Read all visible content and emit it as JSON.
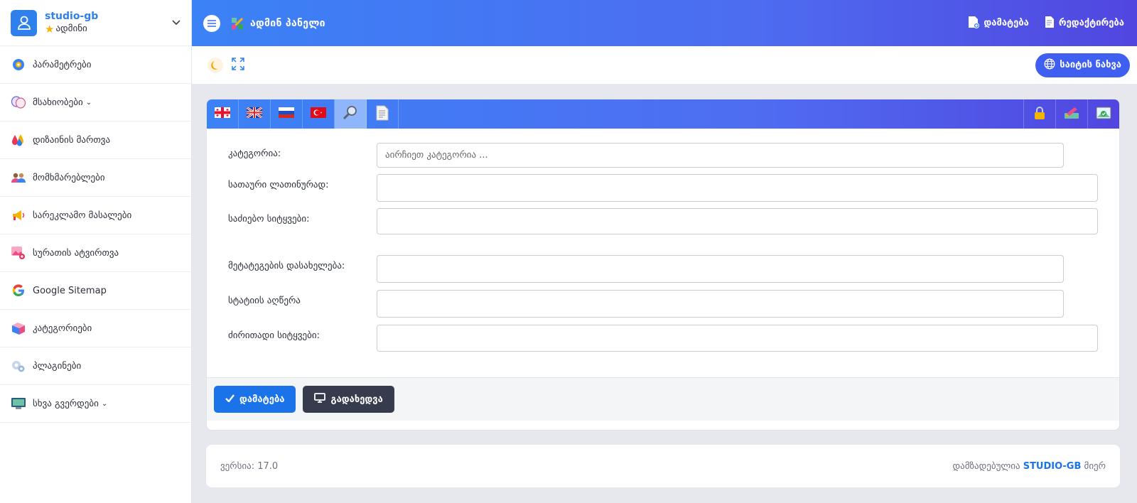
{
  "profile": {
    "name": "studio-gb",
    "role": "ადმინი"
  },
  "sidebar": {
    "items": [
      {
        "label": "პარამეტრები",
        "icon": "gear-icon"
      },
      {
        "label": "მსახიობები",
        "icon": "masks-icon",
        "has_submenu": true
      },
      {
        "label": "დიზაინის მართვა",
        "icon": "paint-drops-icon"
      },
      {
        "label": "მომხმარებლები",
        "icon": "users-icon"
      },
      {
        "label": "სარეკლამო მასალები",
        "icon": "megaphone-icon"
      },
      {
        "label": "სურათის ატვირთვა",
        "icon": "image-upload-icon"
      },
      {
        "label": "Google Sitemap",
        "icon": "google-icon"
      },
      {
        "label": "კატეგორიები",
        "icon": "categories-icon"
      },
      {
        "label": "პლაგინები",
        "icon": "plugins-icon"
      },
      {
        "label": "სხვა გვერდები",
        "icon": "pages-icon",
        "has_submenu": true
      }
    ]
  },
  "header": {
    "title": "ადმინ პანელი",
    "add_label": "დამატება",
    "edit_label": "რედაქტირება"
  },
  "toolbar": {
    "view_site_label": "საიტის ნახვა"
  },
  "tabs": [
    {
      "name": "georgian-flag-icon"
    },
    {
      "name": "uk-flag-icon"
    },
    {
      "name": "russian-flag-icon"
    },
    {
      "name": "turkish-flag-icon"
    },
    {
      "name": "seo-search-icon",
      "active": true
    },
    {
      "name": "document-icon"
    }
  ],
  "right_tabs": [
    {
      "name": "lock-icon"
    },
    {
      "name": "color-edit-icon"
    },
    {
      "name": "image-check-icon"
    }
  ],
  "form": {
    "category_label": "კატეგორია:",
    "category_placeholder": "აირჩიეთ კატეგორია ...",
    "title_latin_label": "სათაური ლათინურად:",
    "search_words_label": "საძიებო სიტყვები:",
    "meta_name_label": "მეტატეგების დასახელება:",
    "description_label": "სტატიის აღწერა",
    "keywords_label": "ძირითადი სიტყვები:"
  },
  "actions": {
    "add_label": "დამატება",
    "preview_label": "გადახედვა"
  },
  "footer": {
    "version": "ვერსია: 17.0",
    "made_by_prefix": "დამზადებულია",
    "made_by_brand": "STUDIO-GB",
    "made_by_suffix": "მიერ"
  }
}
